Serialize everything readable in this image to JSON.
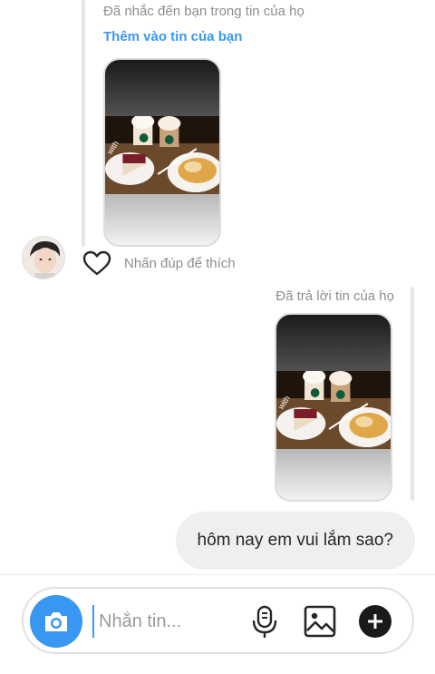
{
  "story_mention": {
    "notice": "Đã nhắc đến bạn trong tin của họ",
    "add_to_story": "Thêm vào tin của bạn",
    "photo_overlay": "with"
  },
  "reaction": {
    "heart_icon": "heart-outline-icon",
    "double_tap_hint": "Nhấn đúp để thích"
  },
  "story_reply": {
    "notice": "Đã trả lời tin của họ",
    "photo_overlay": "with"
  },
  "message": {
    "text": "hôm nay em vui lắm sao?"
  },
  "composer": {
    "placeholder": "Nhắn tin...",
    "camera_icon": "camera-icon",
    "mic_icon": "microphone-icon",
    "gallery_icon": "gallery-icon",
    "plus_icon": "plus-icon"
  },
  "colors": {
    "accent": "#3897f0",
    "bubble": "#efefef",
    "muted_text": "#8e8e8e",
    "plus_button": "#1a1a1a"
  }
}
